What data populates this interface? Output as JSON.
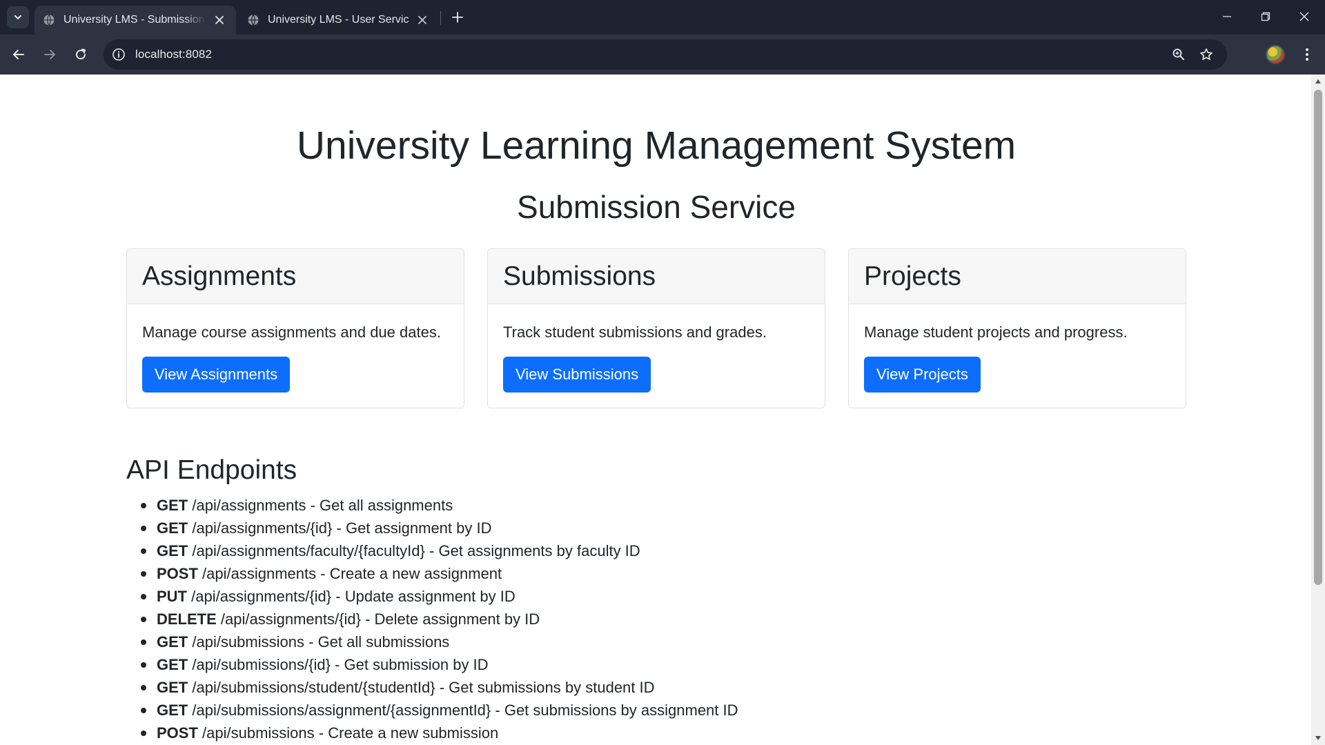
{
  "browser": {
    "tabs": [
      {
        "title": "University LMS - Submission Service",
        "active": true
      },
      {
        "title": "University LMS - User Service",
        "active": false
      }
    ],
    "url": "localhost:8082",
    "icons": {
      "tab_search": "chevron-down-icon",
      "favicon": "globe-icon",
      "tab_close": "close-icon",
      "new_tab": "plus-icon",
      "minimize": "minimize-icon",
      "restore": "restore-icon",
      "close_window": "close-icon",
      "back": "arrow-left-icon",
      "forward": "arrow-right-icon",
      "reload": "reload-icon",
      "site_info": "info-icon",
      "zoom": "zoom-icon",
      "bookmark": "star-icon",
      "profile": "avatar",
      "menu": "more-vertical-icon"
    }
  },
  "page": {
    "title": "University Learning Management System",
    "service_title": "Submission Service",
    "cards": [
      {
        "title": "Assignments",
        "text": "Manage course assignments and due dates.",
        "button": "View Assignments"
      },
      {
        "title": "Submissions",
        "text": "Track student submissions and grades.",
        "button": "View Submissions"
      },
      {
        "title": "Projects",
        "text": "Manage student projects and progress.",
        "button": "View Projects"
      }
    ],
    "api_title": "API Endpoints",
    "endpoints": [
      {
        "method": "GET",
        "path": "/api/assignments",
        "desc": "Get all assignments"
      },
      {
        "method": "GET",
        "path": "/api/assignments/{id}",
        "desc": "Get assignment by ID"
      },
      {
        "method": "GET",
        "path": "/api/assignments/faculty/{facultyId}",
        "desc": "Get assignments by faculty ID"
      },
      {
        "method": "POST",
        "path": "/api/assignments",
        "desc": "Create a new assignment"
      },
      {
        "method": "PUT",
        "path": "/api/assignments/{id}",
        "desc": "Update assignment by ID"
      },
      {
        "method": "DELETE",
        "path": "/api/assignments/{id}",
        "desc": "Delete assignment by ID"
      },
      {
        "method": "GET",
        "path": "/api/submissions",
        "desc": "Get all submissions"
      },
      {
        "method": "GET",
        "path": "/api/submissions/{id}",
        "desc": "Get submission by ID"
      },
      {
        "method": "GET",
        "path": "/api/submissions/student/{studentId}",
        "desc": "Get submissions by student ID"
      },
      {
        "method": "GET",
        "path": "/api/submissions/assignment/{assignmentId}",
        "desc": "Get submissions by assignment ID"
      },
      {
        "method": "POST",
        "path": "/api/submissions",
        "desc": "Create a new submission"
      }
    ],
    "separator": " - "
  },
  "colors": {
    "primary_button": "#0d6efd",
    "text": "#212529",
    "chrome_dark": "#1d2330",
    "chrome_toolbar": "#2d3341"
  }
}
